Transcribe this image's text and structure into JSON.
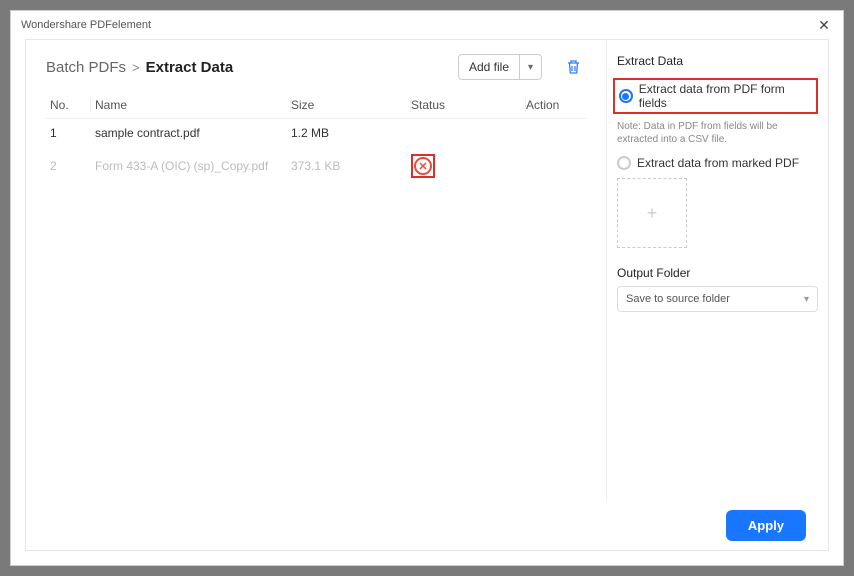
{
  "app_title": "Wondershare PDFelement",
  "breadcrumb": {
    "root": "Batch PDFs",
    "sep": ">",
    "current": "Extract Data"
  },
  "toolbar": {
    "add_file": "Add file"
  },
  "columns": {
    "no": "No.",
    "name": "Name",
    "size": "Size",
    "status": "Status",
    "action": "Action"
  },
  "rows": [
    {
      "no": "1",
      "name": "sample contract.pdf",
      "size": "1.2 MB",
      "disabled": false,
      "status_badge": false
    },
    {
      "no": "2",
      "name": "Form 433-A (OIC) (sp)_Copy.pdf",
      "size": "373.1 KB",
      "disabled": true,
      "status_badge": true
    }
  ],
  "panel": {
    "title": "Extract Data",
    "opt_form_fields": "Extract data from PDF form fields",
    "note": "Note: Data in PDF from fields will be extracted into a CSV file.",
    "opt_marked": "Extract data from marked PDF",
    "output_label": "Output Folder",
    "output_value": "Save to source folder"
  },
  "footer": {
    "apply": "Apply"
  }
}
